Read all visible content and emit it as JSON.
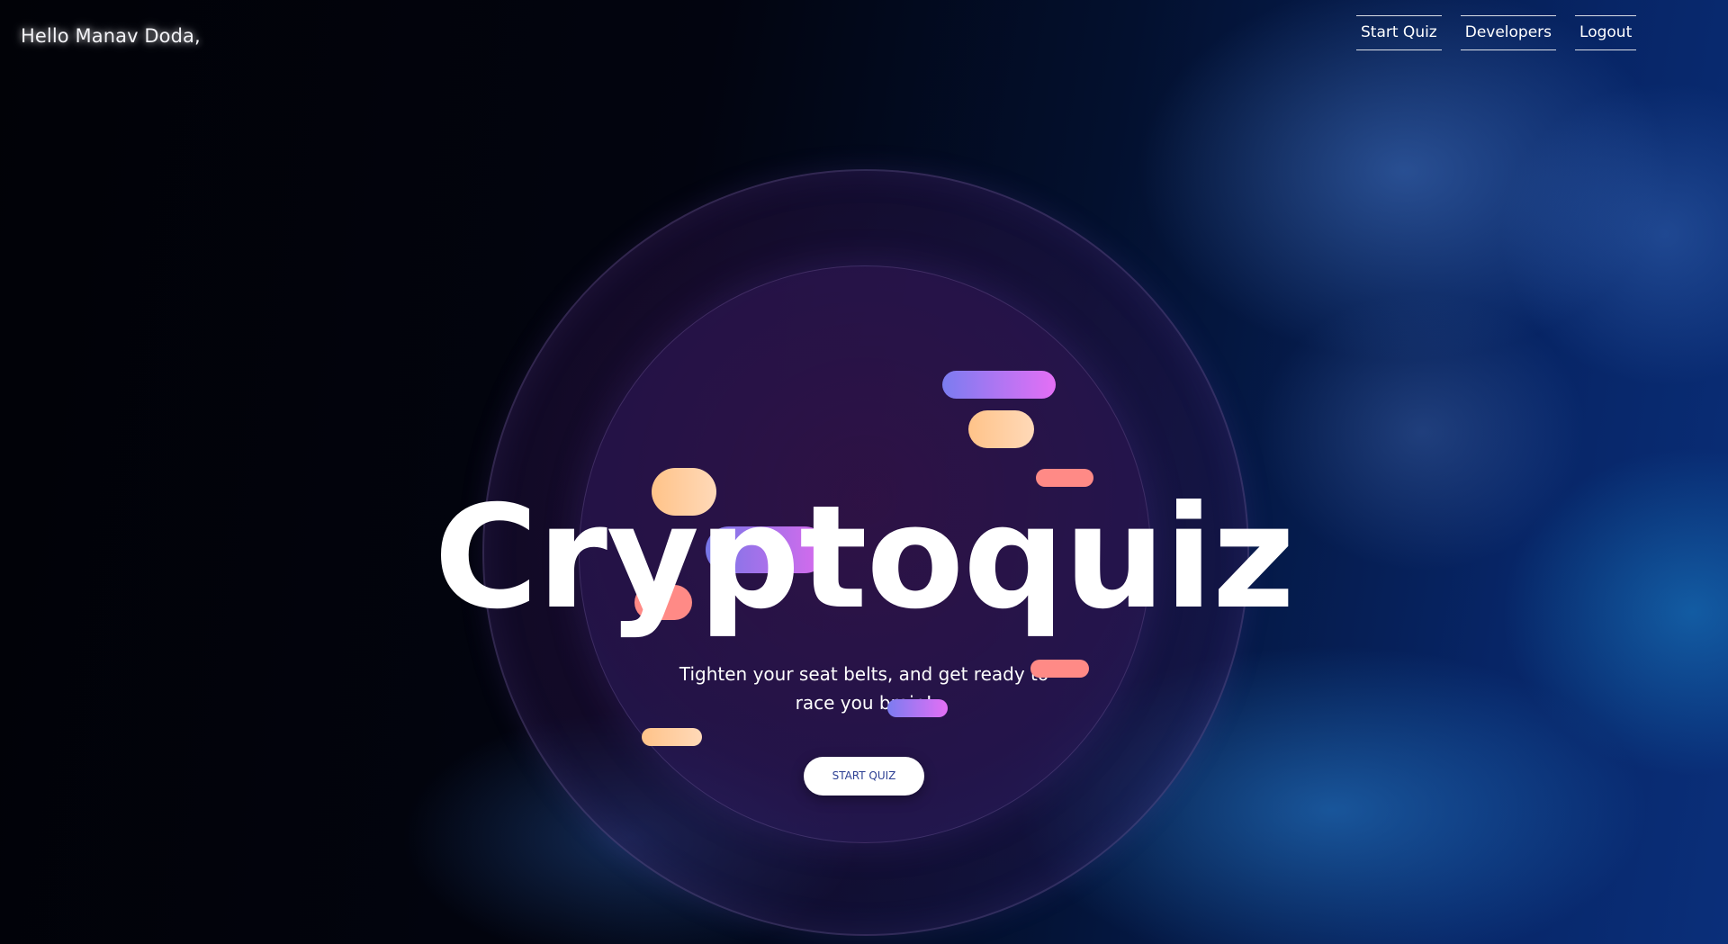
{
  "header": {
    "greeting": "Hello Manav Doda,"
  },
  "nav": {
    "items": [
      {
        "label": "Start Quiz"
      },
      {
        "label": "Developers"
      },
      {
        "label": "Logout"
      }
    ]
  },
  "hero": {
    "title": "Cryptoquiz",
    "subtitle": "Tighten your seat belts, and get ready to race you brain!",
    "cta_label": "START QUIZ"
  },
  "colors": {
    "accent_purple_start": "#7b7cf0",
    "accent_purple_end": "#e46ff5",
    "accent_peach": "#ffc389",
    "accent_salmon": "#ff8a86",
    "cta_text": "#2c3f93"
  }
}
